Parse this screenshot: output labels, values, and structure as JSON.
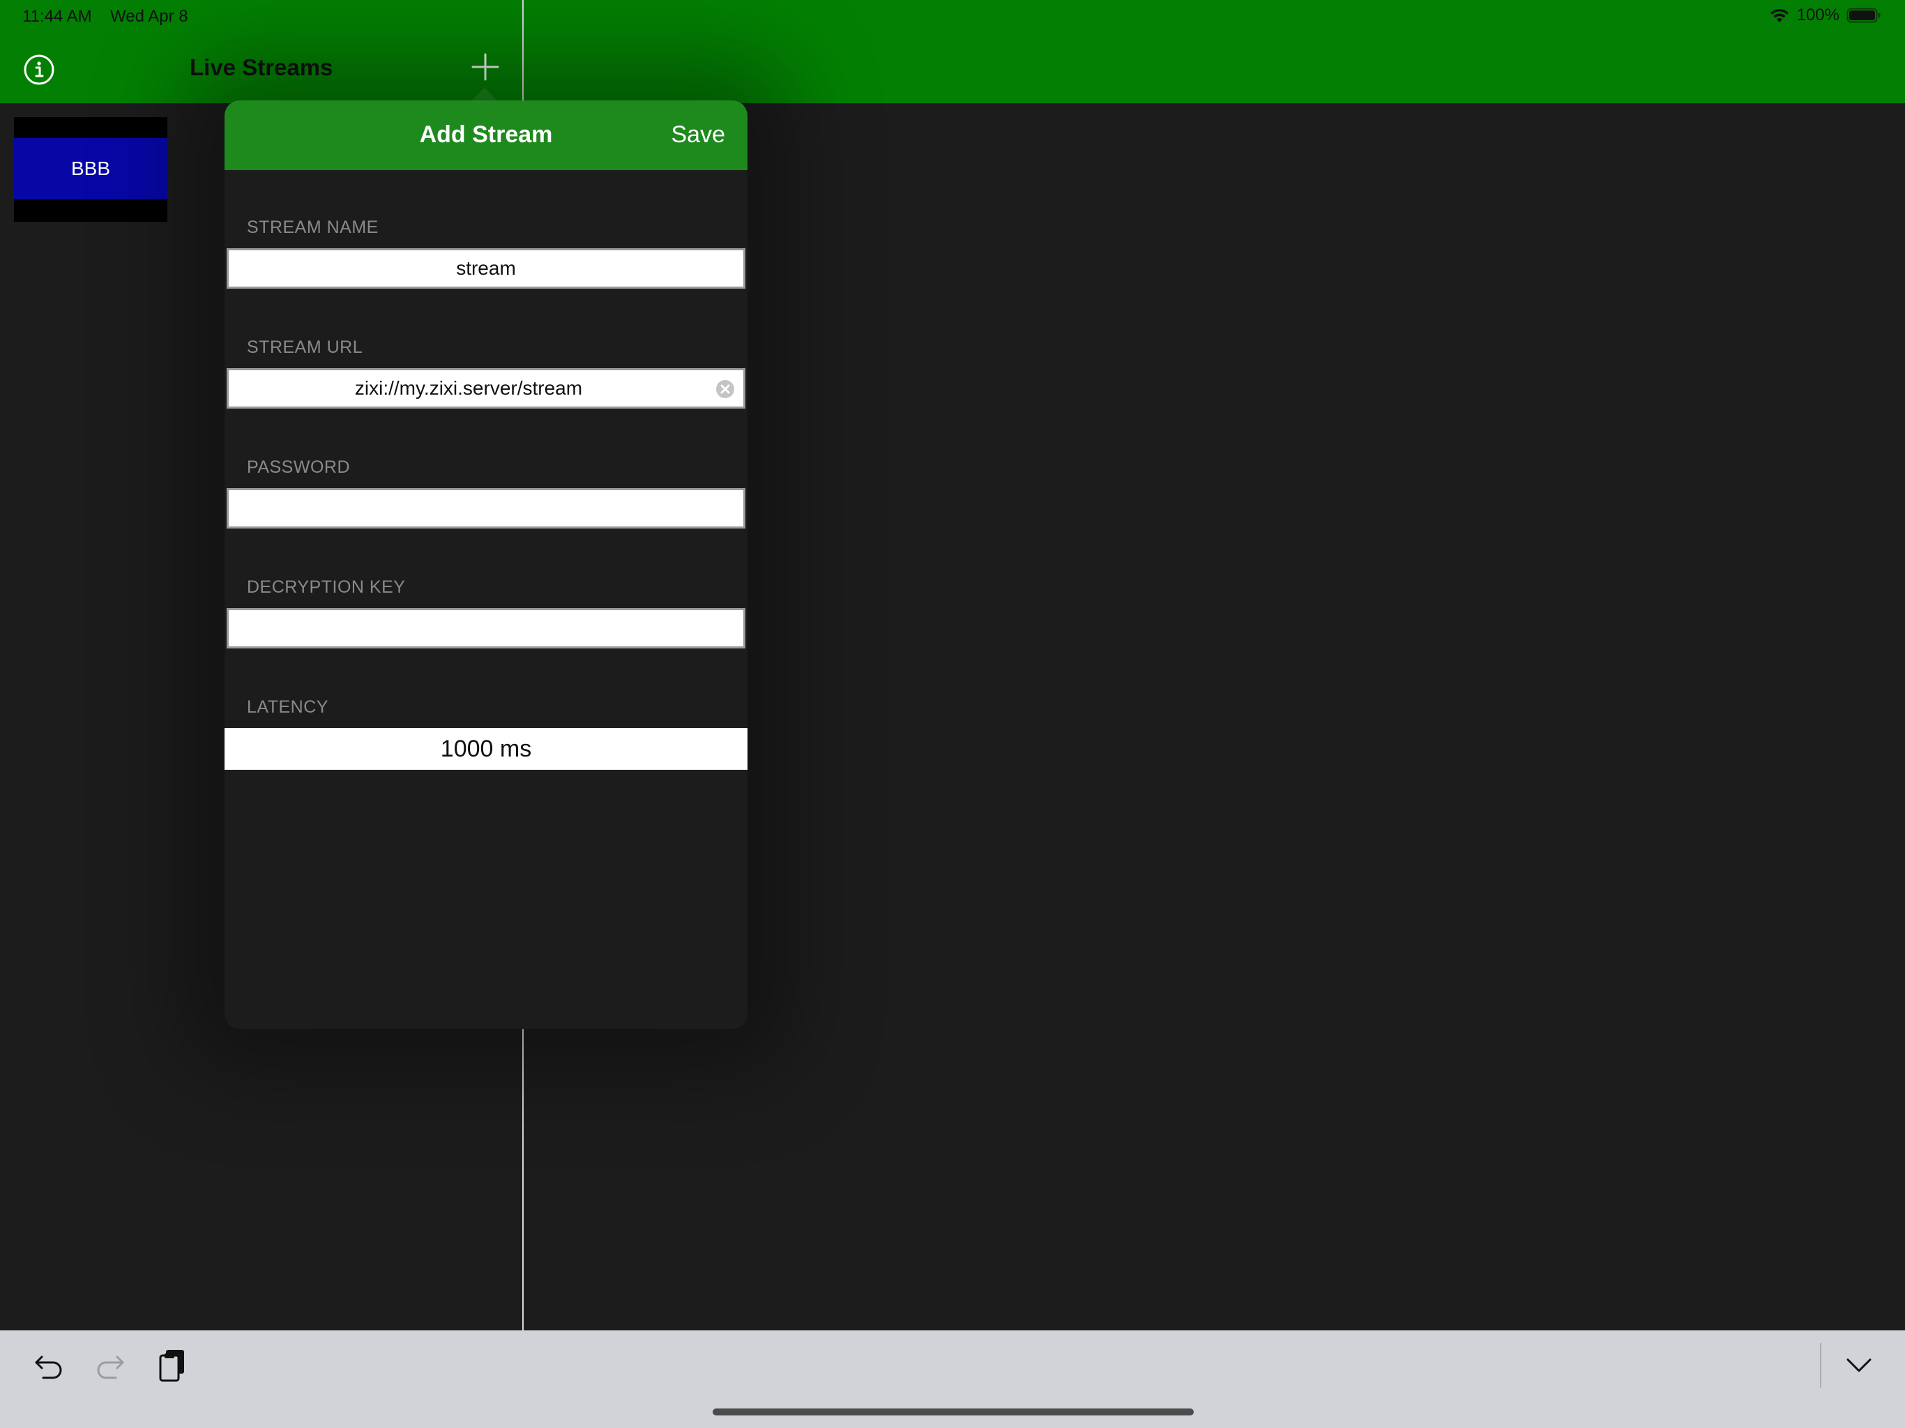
{
  "status_bar": {
    "time": "11:44 AM",
    "date": "Wed Apr 8",
    "battery": "100%",
    "wifi_icon": "wifi-icon",
    "battery_icon": "battery-icon"
  },
  "nav": {
    "title": "Live Streams",
    "info_icon": "info-icon",
    "add_icon": "plus-icon"
  },
  "streams": [
    {
      "label": "BBB"
    }
  ],
  "popover": {
    "title": "Add Stream",
    "save_label": "Save",
    "fields": {
      "stream_name": {
        "label": "STREAM NAME",
        "value": "stream"
      },
      "stream_url": {
        "label": "STREAM URL",
        "value": "zixi://my.zixi.server/stream"
      },
      "password": {
        "label": "PASSWORD",
        "value": ""
      },
      "decryption_key": {
        "label": "DECRYPTION KEY",
        "value": ""
      },
      "latency": {
        "label": "LATENCY",
        "value": "1000 ms"
      }
    }
  },
  "toolbar": {
    "undo_icon": "undo-icon",
    "redo_icon": "redo-icon",
    "paste_icon": "paste-icon",
    "dismiss_icon": "chevron-down-icon"
  },
  "colors": {
    "nav_green": "#038003",
    "popover_header_green": "#1e8a1e",
    "background": "#1c1c1c",
    "thumbnail_blue": "#0707a6",
    "keyboard_bar": "#d1d3d8"
  }
}
